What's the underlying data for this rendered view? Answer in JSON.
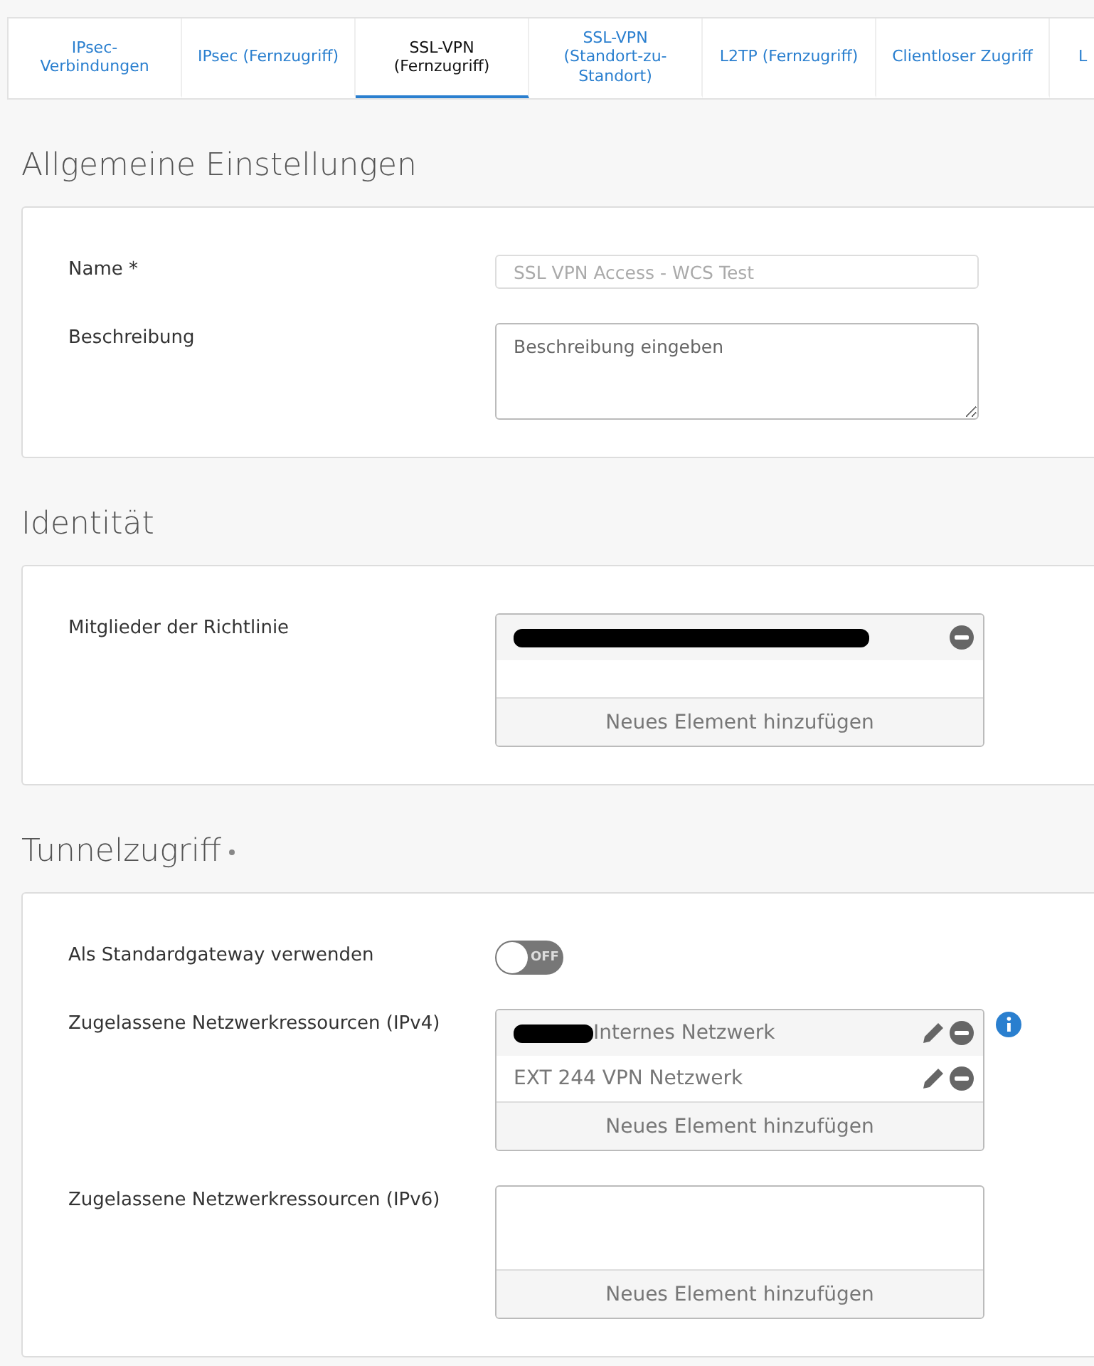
{
  "tabs": [
    {
      "label": "IPsec-\nVerbindungen",
      "selected": false
    },
    {
      "label": "IPsec (Fernzugriff)",
      "selected": false
    },
    {
      "label": "SSL-VPN\n(Fernzugriff)",
      "selected": true
    },
    {
      "label": "SSL-VPN\n(Standort-zu-\nStandort)",
      "selected": false
    },
    {
      "label": "L2TP (Fernzugriff)",
      "selected": false
    },
    {
      "label": "Clientloser Zugriff",
      "selected": false
    },
    {
      "label": "L",
      "selected": false
    }
  ],
  "sections": [
    {
      "title": "Allgemeine Einstellungen",
      "required": false,
      "fields": [
        {
          "kind": "text",
          "label": "Name *",
          "value": "SSL VPN Access - WCS Test",
          "disabled": true
        },
        {
          "kind": "textarea",
          "label": "Beschreibung",
          "placeholder": "Beschreibung eingeben"
        }
      ]
    },
    {
      "title": "Identität",
      "required": false,
      "fields": [
        {
          "kind": "list",
          "label": "Mitglieder der Richtlinie",
          "info": false,
          "items": [
            {
              "redacted": true,
              "editable": false
            }
          ],
          "add_label": "Neues Element hinzufügen"
        }
      ]
    },
    {
      "title": "Tunnelzugriff",
      "required": true,
      "fields": [
        {
          "kind": "toggle",
          "label": "Als Standardgateway verwenden",
          "on": false,
          "state_label": "OFF"
        },
        {
          "kind": "list",
          "label": "Zugelassene Netzwerkressourcen (IPv4)",
          "info": true,
          "items": [
            {
              "redacted": true,
              "text": "Internes Netzwerk",
              "editable": true
            },
            {
              "redacted": false,
              "text": "EXT 244 VPN Netzwerk",
              "editable": true
            }
          ],
          "add_label": "Neues Element hinzufügen"
        },
        {
          "kind": "list",
          "label": "Zugelassene Netzwerkressourcen (IPv6)",
          "info": false,
          "add_label": "Neues Element hinzufügen"
        }
      ]
    }
  ]
}
